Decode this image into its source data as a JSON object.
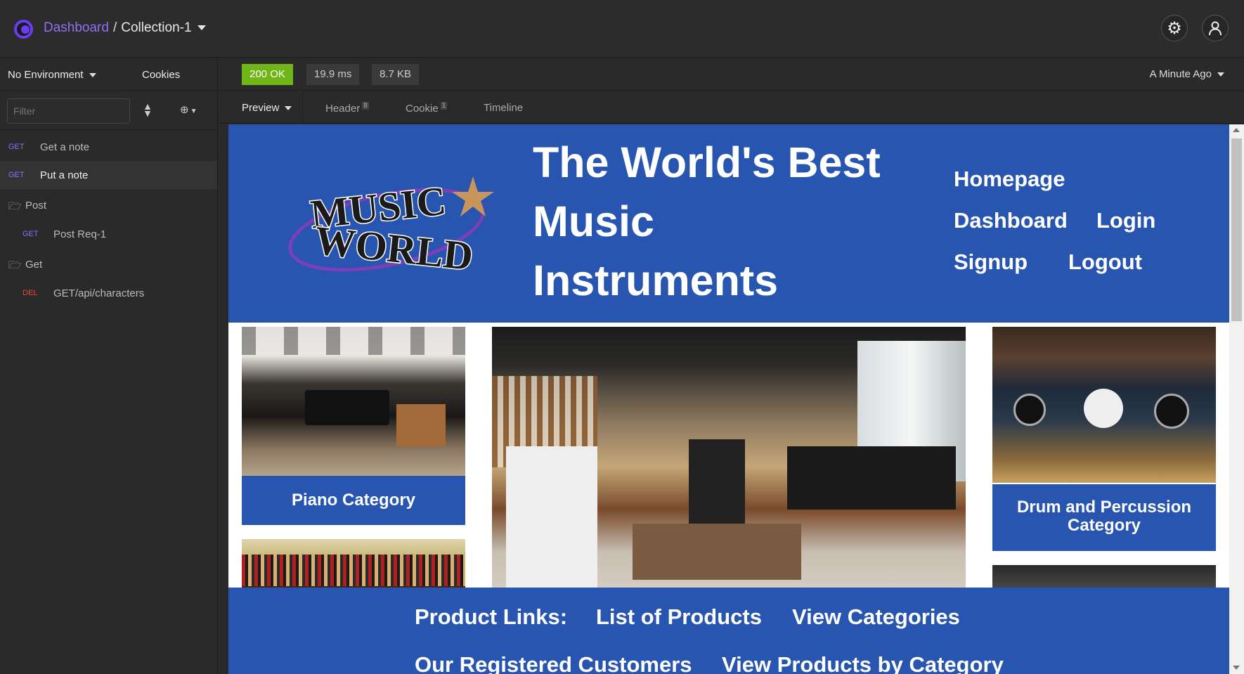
{
  "topbar": {
    "dashboard": "Dashboard",
    "separator": "/",
    "collection": "Collection-1"
  },
  "sidebar": {
    "environment": "No Environment",
    "cookies": "Cookies",
    "filter_placeholder": "Filter",
    "requests": [
      {
        "method": "GET",
        "name": "Get a note"
      },
      {
        "method": "GET",
        "name": "Put a note"
      }
    ],
    "folders": [
      {
        "name": "Post",
        "items": [
          {
            "method": "GET",
            "name": "Post Req-1"
          }
        ]
      },
      {
        "name": "Get",
        "items": [
          {
            "method": "DEL",
            "name": "GET/api/characters"
          }
        ]
      }
    ]
  },
  "response": {
    "status": "200 OK",
    "time": "19.9 ms",
    "size": "8.7 KB",
    "ago": "A Minute Ago",
    "tabs": {
      "preview": "Preview",
      "header": "Header",
      "header_count": "8",
      "cookie": "Cookie",
      "cookie_count": "1",
      "timeline": "Timeline"
    }
  },
  "preview": {
    "logo_line1": "MUSIC",
    "logo_line2": "WORLD",
    "headline_1": "The World's Best",
    "headline_2": "Music",
    "headline_3": "Instruments",
    "nav": {
      "homepage": "Homepage",
      "dashboard": "Dashboard",
      "login": "Login",
      "signup": "Signup",
      "logout": "Logout"
    },
    "piano_card": "Piano Category",
    "drum_card_1": "Drum and Percussion",
    "drum_card_2": "Category",
    "footer": {
      "product_links": "Product Links:",
      "list_products": "List of Products",
      "view_categories": "View Categories",
      "customers": "Our Registered Customers",
      "by_category": "View Products by Category"
    }
  },
  "colors": {
    "accent": "#8f6ff5",
    "ok": "#6eb515",
    "delete": "#e5483b",
    "page_blue": "#2755b0"
  }
}
